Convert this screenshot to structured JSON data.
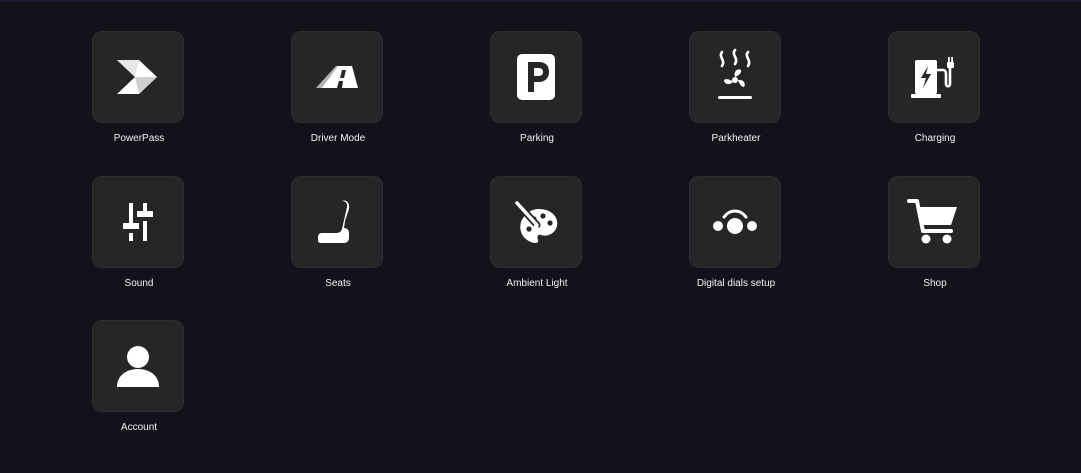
{
  "apps": [
    {
      "label": "PowerPass",
      "icon": "powerpass-icon"
    },
    {
      "label": "Driver Mode",
      "icon": "driver-mode-road-icon"
    },
    {
      "label": "Parking",
      "icon": "parking-p-icon"
    },
    {
      "label": "Parkheater",
      "icon": "parkheater-fan-heat-icon"
    },
    {
      "label": "Charging",
      "icon": "charging-station-icon"
    },
    {
      "label": "Sound",
      "icon": "sound-sliders-icon"
    },
    {
      "label": "Seats",
      "icon": "car-seat-icon"
    },
    {
      "label": "Ambient Light",
      "icon": "palette-brush-icon"
    },
    {
      "label": "Digital dials setup",
      "icon": "digital-dials-icon"
    },
    {
      "label": "Shop",
      "icon": "shopping-cart-icon"
    },
    {
      "label": "Account",
      "icon": "user-account-icon"
    }
  ],
  "colors": {
    "background": "#13111a",
    "tile": "#262628",
    "icon": "#ffffff",
    "label": "#f2f2f4"
  }
}
